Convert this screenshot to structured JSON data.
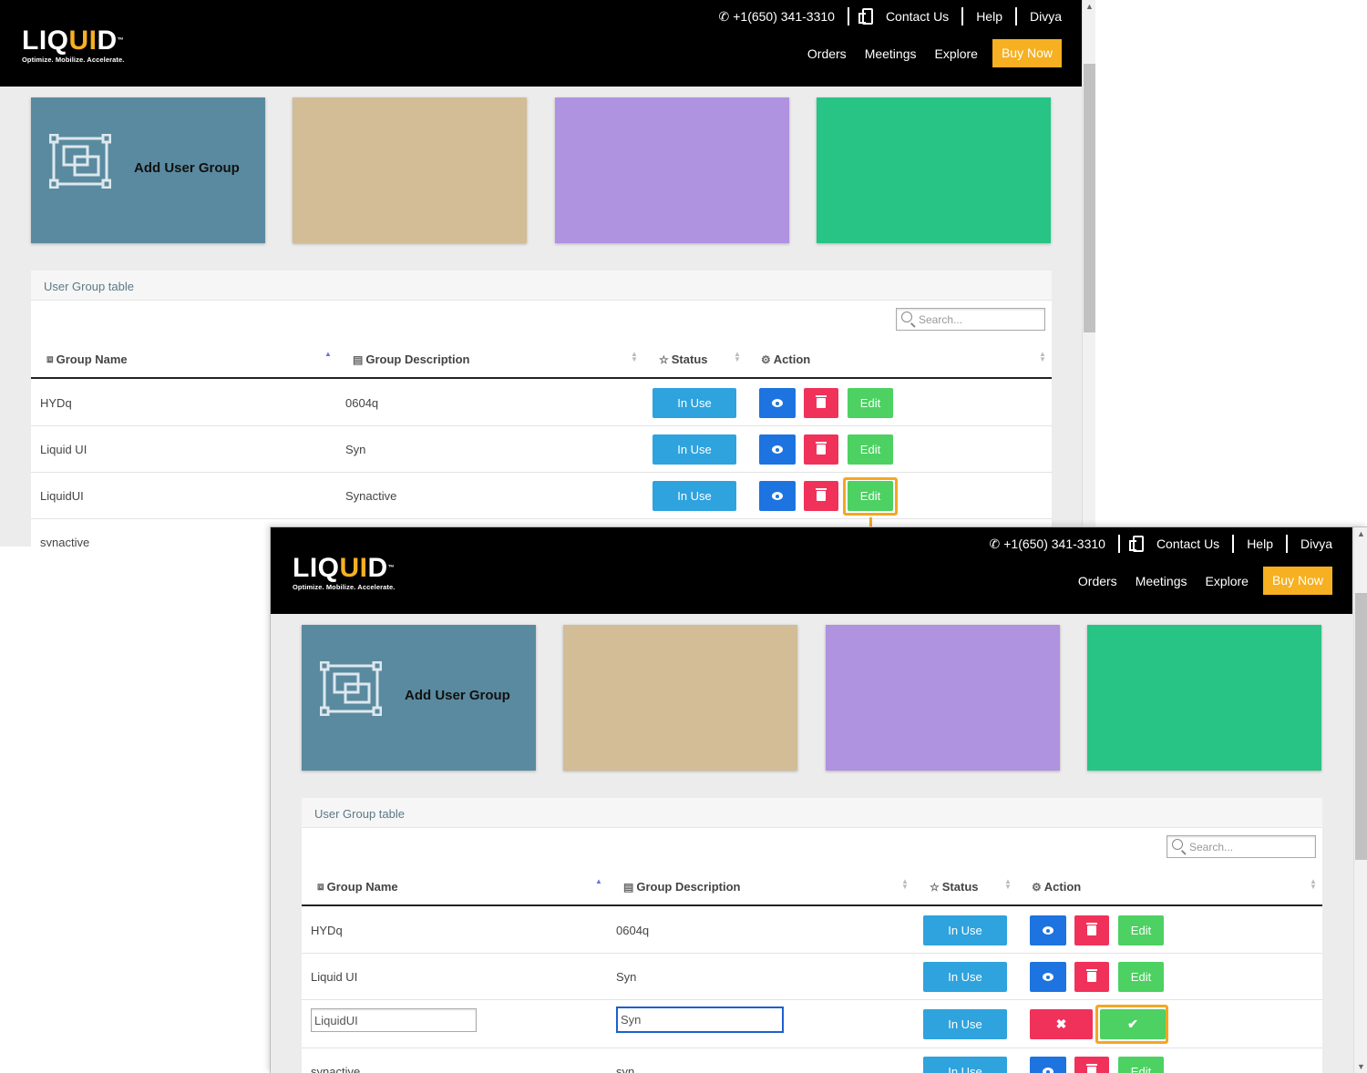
{
  "header": {
    "logo_word_a": "LIQ",
    "logo_word_b": "UI",
    "logo_word_c": "D",
    "logo_tm": "™",
    "logo_tagline": "Optimize. Mobilize. Accelerate.",
    "phone": "+1(650) 341-3310",
    "contact_us": "Contact Us",
    "help": "Help",
    "user": "Divya",
    "nav": [
      "Orders",
      "Meetings",
      "Explore"
    ],
    "buy_now": "Buy Now"
  },
  "tiles": {
    "add_user_group": "Add User Group"
  },
  "table": {
    "title": "User Group table",
    "search_placeholder": "Search...",
    "columns": [
      "Group Name",
      "Group Description",
      "Status",
      "Action"
    ],
    "status_label": "In Use",
    "edit_label": "Edit",
    "rows": [
      {
        "name": "HYDq",
        "description": "0604q"
      },
      {
        "name": "Liquid UI",
        "description": "Syn"
      },
      {
        "name": "LiquidUI",
        "description": "Synactive"
      },
      {
        "name": "synactive",
        "description": "syn"
      }
    ]
  },
  "edit_state": {
    "name_value": "LiquidUI",
    "description_value": "Syn"
  },
  "icons": {
    "phone": "phone-icon",
    "device": "device-icon",
    "group": "group-icon",
    "description": "description-icon",
    "status": "star-icon",
    "action": "gear-icon",
    "view": "eye-icon",
    "delete": "trash-icon",
    "cancel": "x-icon",
    "save": "check-icon"
  },
  "colors": {
    "accent": "#f6b021",
    "highlight": "#f5a623",
    "tile_blue": "#5a8a9f",
    "tile_tan": "#d2bd96",
    "tile_purple": "#af92e0",
    "tile_green": "#27c485",
    "in_use": "#2ea3de",
    "view": "#1d74e0",
    "delete": "#f0325a",
    "edit": "#4cd162"
  }
}
